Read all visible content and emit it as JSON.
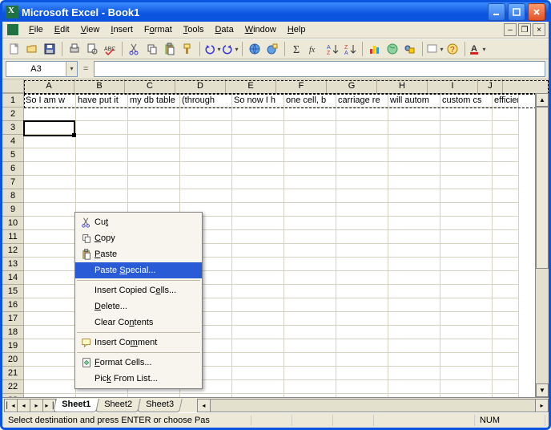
{
  "titlebar": {
    "text": "Microsoft Excel - Book1"
  },
  "menu": {
    "items": [
      "File",
      "Edit",
      "View",
      "Insert",
      "Format",
      "Tools",
      "Data",
      "Window",
      "Help"
    ],
    "underline_index": [
      0,
      0,
      0,
      0,
      1,
      0,
      0,
      0,
      0
    ]
  },
  "namebox": {
    "ref": "A3"
  },
  "columns": [
    "A",
    "B",
    "C",
    "D",
    "E",
    "F",
    "G",
    "H",
    "I",
    "J"
  ],
  "rows_visible": 23,
  "row1_cells": [
    "So I am w",
    "have put it",
    "my db table",
    "(through",
    "So now I h",
    "one cell, b",
    "carriage re",
    "will autom",
    "custom cs",
    "efficient w"
  ],
  "active_cell": {
    "col": 0,
    "row": 2
  },
  "context_menu": {
    "items": [
      {
        "icon": "cut",
        "label": "Cu<u>t</u>"
      },
      {
        "icon": "copy",
        "label": "<u>C</u>opy"
      },
      {
        "icon": "paste",
        "label": "<u>P</u>aste"
      },
      {
        "icon": "",
        "label": "Paste <u>S</u>pecial...",
        "highlight": true
      },
      {
        "sep": true
      },
      {
        "icon": "",
        "label": "Insert Copied C<u>e</u>lls..."
      },
      {
        "icon": "",
        "label": "<u>D</u>elete..."
      },
      {
        "icon": "",
        "label": "Clear Co<u>n</u>tents"
      },
      {
        "sep": true
      },
      {
        "icon": "comment",
        "label": "Insert Co<u>m</u>ment"
      },
      {
        "sep": true
      },
      {
        "icon": "format",
        "label": "<u>F</u>ormat Cells..."
      },
      {
        "icon": "",
        "label": "Pic<u>k</u> From List..."
      }
    ]
  },
  "sheets": {
    "active": 0,
    "tabs": [
      "Sheet1",
      "Sheet2",
      "Sheet3"
    ]
  },
  "statusbar": {
    "msg": "Select destination and press ENTER or choose Pas",
    "indicator": "NUM"
  }
}
